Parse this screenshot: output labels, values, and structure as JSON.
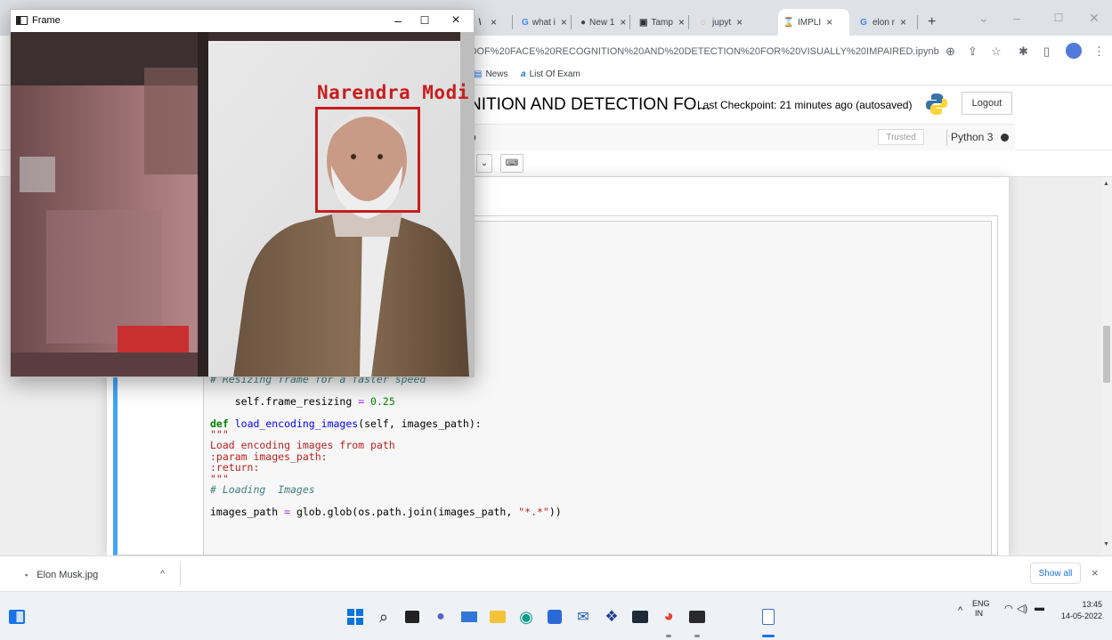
{
  "browser": {
    "tabs": [
      {
        "label": "",
        "icon": "generic-tab-icon",
        "close": "×"
      },
      {
        "label": "what i",
        "icon": "google-icon",
        "close": "×"
      },
      {
        "label": "New 1",
        "icon": "chrome-icon",
        "close": "×"
      },
      {
        "label": "Tamp",
        "icon": "tampermonkey-icon",
        "close": "×"
      },
      {
        "label": "jupyt",
        "icon": "jupyter-icon",
        "close": "×"
      },
      {
        "label": "IMPLI",
        "icon": "hourglass-icon",
        "close": "×",
        "active": true
      },
      {
        "label": "elon r",
        "icon": "google-icon",
        "close": "×"
      }
    ],
    "new_tab": "+",
    "url": "OOF%20FACE%20RECOGNITION%20AND%20DETECTION%20FOR%20VISUALLY%20IMPAIRED.ipynb",
    "bookmarks": [
      "News",
      "List Of Exam"
    ]
  },
  "jupyter": {
    "notebook_title": "NITION AND DETECTION FO...",
    "checkpoint": "Last Checkpoint: 21 minutes ago  (autosaved)",
    "logout": "Logout",
    "menu_fragment": "p",
    "trusted": "Trusted",
    "kernel": "Python 3",
    "dropdown_caret": "⌄",
    "keyboard_icon": "⌨"
  },
  "code_lines": {
    "l1": "# Resizing frame for a faster speed",
    "l2a": "self.frame_resizing ",
    "l2b": "=",
    "l2c": " 0.25",
    "l3a": "def",
    "l3b": "load_encoding_images",
    "l3c": "(self, images_path):",
    "l4": "\"\"\"",
    "l5": "Load encoding images from path",
    "l6": ":param images_path:",
    "l7": ":return:",
    "l8": "\"\"\"",
    "l9": "# Loading  Images",
    "l10a": "images_path ",
    "l10b": "=",
    "l10c": " glob.glob(os.path.join(images_path, ",
    "l10d": "\"*.*\"",
    "l10e": "))"
  },
  "downloads": {
    "file": "Elon Musk.jpg",
    "caret": "^",
    "show_all": "Show all",
    "close": "×"
  },
  "frame": {
    "title": "Frame",
    "minimize": "–",
    "maximize": "☐",
    "close": "×",
    "face_label": "Narendra Modi"
  },
  "taskbar": {
    "tray_lang_1": "ENG",
    "tray_lang_2": "IN",
    "time": "13:45",
    "date": "14-05-2022"
  },
  "colors": {
    "face_box": "#c81d1d",
    "cell_active_border": "#42a5f5",
    "chrome_bg": "#dee1e6"
  }
}
